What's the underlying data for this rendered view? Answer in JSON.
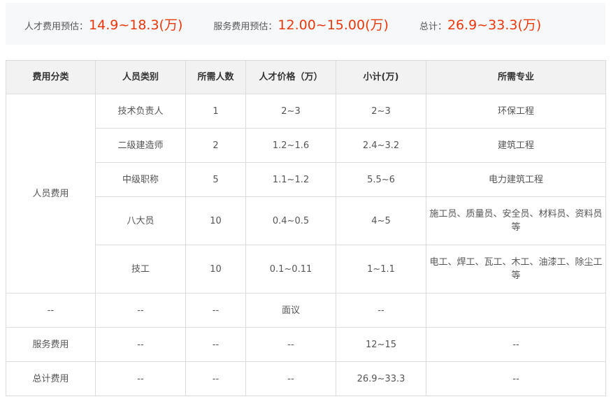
{
  "summary": {
    "talent_label": "人才费用预估：",
    "talent_value": "14.9~18.3(万)",
    "service_label": "服务费用预估：",
    "service_value": "12.00~15.00(万)",
    "total_label": "总计：",
    "total_value": "26.9~33.3(万)"
  },
  "table": {
    "headers": [
      "费用分类",
      "人员类别",
      "所需人数",
      "人才价格（万）",
      "小计(万)",
      "所需专业"
    ],
    "personnel_category": "人员费用",
    "personnel_rows": [
      {
        "type": "技术负责人",
        "count": "1",
        "price": "2~3",
        "subtotal": "2~3",
        "major": "环保工程"
      },
      {
        "type": "二级建造师",
        "count": "2",
        "price": "1.2~1.6",
        "subtotal": "2.4~3.2",
        "major": "建筑工程"
      },
      {
        "type": "中级职称",
        "count": "5",
        "price": "1.1~1.2",
        "subtotal": "5.5~6",
        "major": "电力建筑工程"
      },
      {
        "type": "八大员",
        "count": "10",
        "price": "0.4~0.5",
        "subtotal": "4~5",
        "major": "施工员、质量员、安全员、材料员、资料员等"
      },
      {
        "type": "技工",
        "count": "10",
        "price": "0.1~0.11",
        "subtotal": "1~1.1",
        "major": "电工、焊工、瓦工、木工、油漆工、除尘工等"
      }
    ],
    "negotiable_row": {
      "category": "--",
      "type": "--",
      "count": "--",
      "price": "面议",
      "subtotal": "--",
      "major": ""
    },
    "service_row": {
      "category": "服务费用",
      "type": "--",
      "count": "--",
      "price": "--",
      "subtotal": "12~15",
      "major": "--"
    },
    "total_row": {
      "category": "总计费用",
      "type": "--",
      "count": "--",
      "price": "--",
      "subtotal": "26.9~33.3",
      "major": "--"
    }
  },
  "colors": {
    "accent_red": "#e8380d",
    "link_blue": "#2b8ad1",
    "header_bg": "#f2f2f2",
    "border": "#dcdcdc",
    "summary_bg": "#f7f8fa"
  }
}
